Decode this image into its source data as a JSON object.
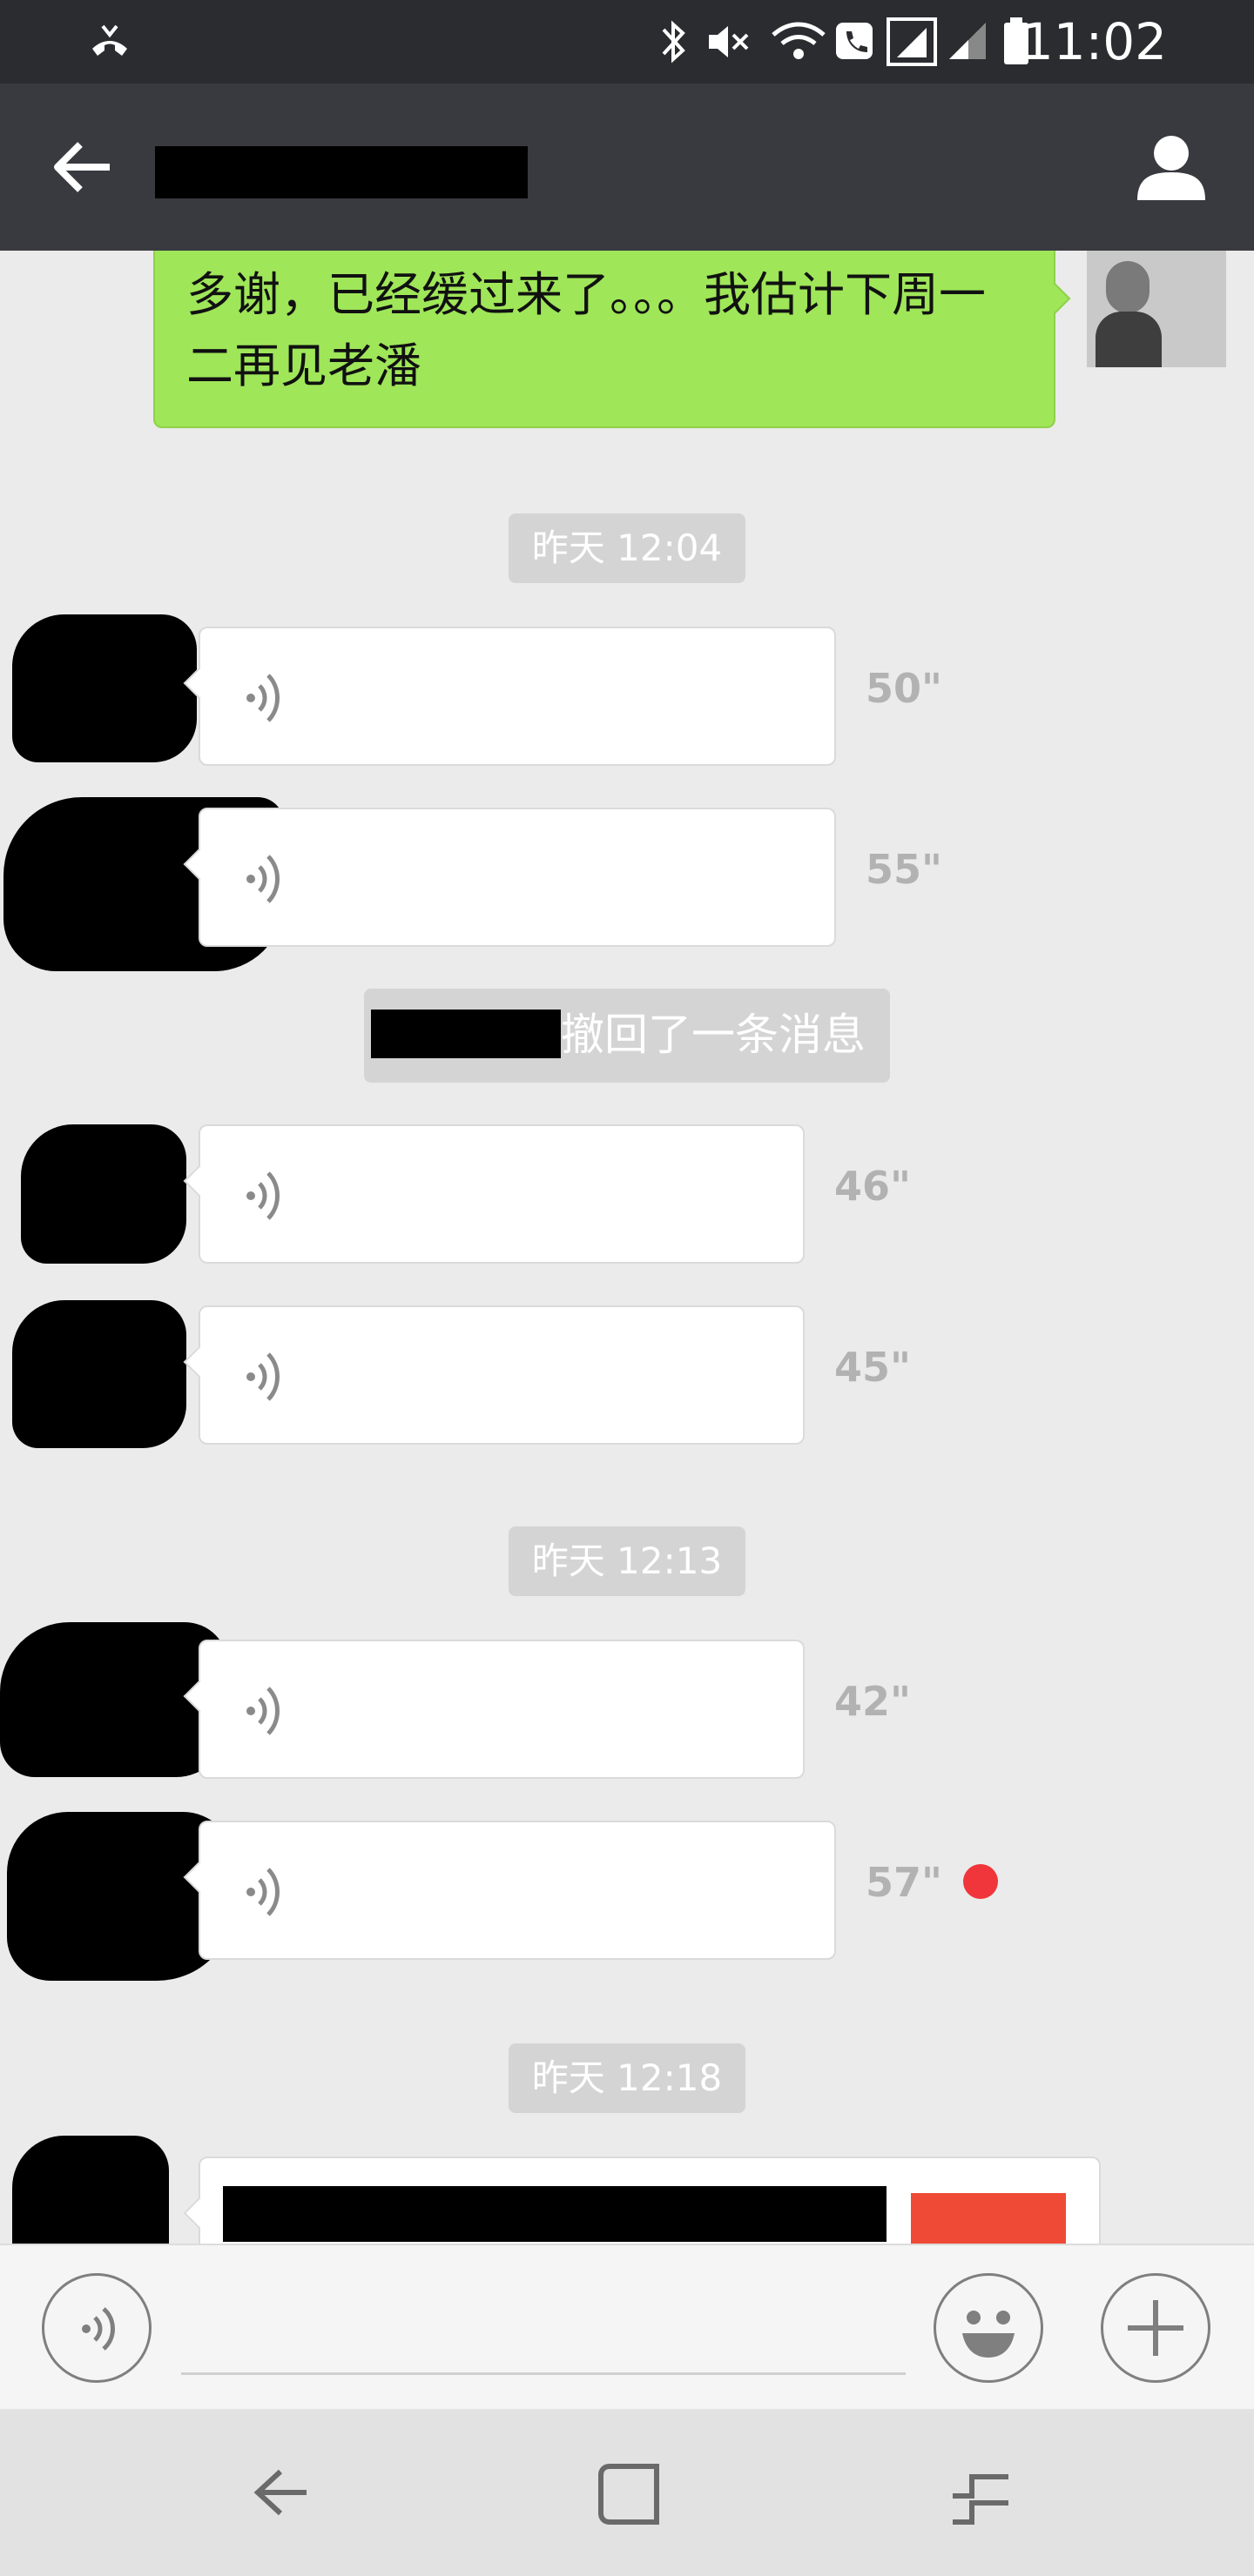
{
  "status_bar": {
    "time": "11:02"
  },
  "header": {
    "back_label": "back",
    "contact_label": "contact info"
  },
  "messages": {
    "outgoing_text": "多谢，已经缓过来了。。。我估计下周一二再见老潘",
    "timestamps": [
      "昨天 12:04",
      "昨天 12:13",
      "昨天 12:18"
    ],
    "recall_notice": "撤回了一条消息",
    "voice_durations": [
      "50\"",
      "55\"",
      "46\"",
      "45\"",
      "42\"",
      "57\""
    ]
  },
  "colors": {
    "status_bar_bg": "#2b2c30",
    "title_bar_bg": "#393a3f",
    "chat_bg": "#ebebeb",
    "outgoing_bubble": "#9fe659",
    "unread_dot": "#f0353b"
  }
}
